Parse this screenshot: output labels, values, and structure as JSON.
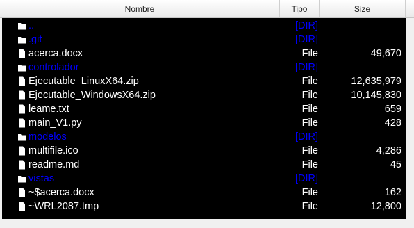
{
  "columns": {
    "name": "Nombre",
    "type": "Tipo",
    "size": "Size"
  },
  "files": [
    {
      "kind": "dir",
      "icon": "folder-icon",
      "name": "..",
      "type": "[DIR]",
      "size": ""
    },
    {
      "kind": "dir",
      "icon": "folder-icon",
      "name": ".git",
      "type": "[DIR]",
      "size": ""
    },
    {
      "kind": "file",
      "icon": "file-icon",
      "name": "acerca.docx",
      "type": "File",
      "size": "49,670"
    },
    {
      "kind": "dir",
      "icon": "folder-icon",
      "name": "controlador",
      "type": "[DIR]",
      "size": ""
    },
    {
      "kind": "file",
      "icon": "file-icon",
      "name": "Ejecutable_LinuxX64.zip",
      "type": "File",
      "size": "12,635,979"
    },
    {
      "kind": "file",
      "icon": "file-icon",
      "name": "Ejecutable_WindowsX64.zip",
      "type": "File",
      "size": "10,145,830"
    },
    {
      "kind": "file",
      "icon": "file-icon",
      "name": "leame.txt",
      "type": "File",
      "size": "659"
    },
    {
      "kind": "file",
      "icon": "file-icon",
      "name": "main_V1.py",
      "type": "File",
      "size": "428"
    },
    {
      "kind": "dir",
      "icon": "folder-icon",
      "name": "modelos",
      "type": "[DIR]",
      "size": ""
    },
    {
      "kind": "file",
      "icon": "file-icon",
      "name": "multifile.ico",
      "type": "File",
      "size": "4,286"
    },
    {
      "kind": "file",
      "icon": "file-icon",
      "name": "readme.md",
      "type": "File",
      "size": "45"
    },
    {
      "kind": "dir",
      "icon": "folder-icon",
      "name": "vistas",
      "type": "[DIR]",
      "size": ""
    },
    {
      "kind": "file",
      "icon": "file-icon",
      "name": "~$acerca.docx",
      "type": "File",
      "size": "162"
    },
    {
      "kind": "file",
      "icon": "file-icon",
      "name": "~WRL2087.tmp",
      "type": "File",
      "size": "12,800"
    }
  ],
  "colors": {
    "background": "#000000",
    "file_text": "#ffffff",
    "dir_text": "#0000ff"
  }
}
